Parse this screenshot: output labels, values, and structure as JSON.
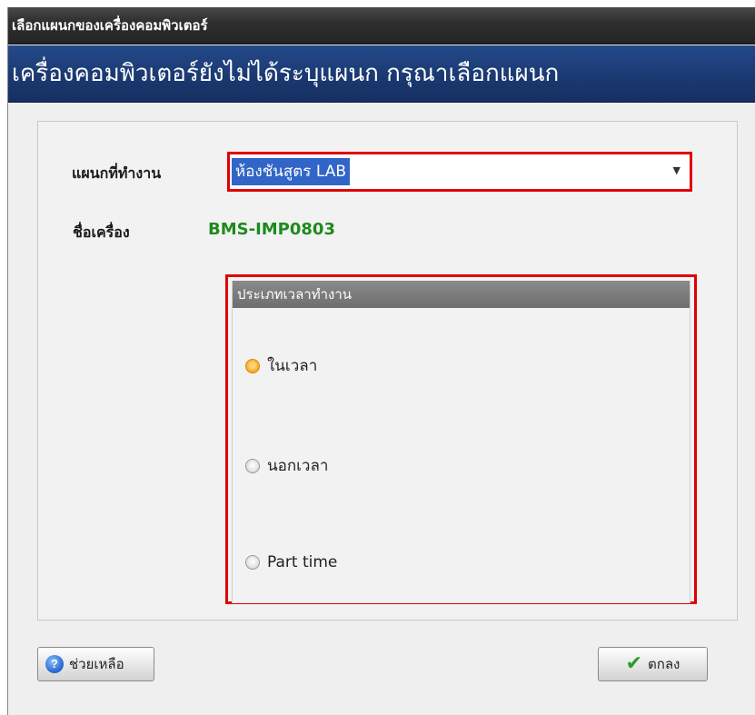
{
  "window": {
    "title": "เลือกแผนกของเครื่องคอมพิวเตอร์",
    "banner": "เครื่องคอมพิวเตอร์ยังไม่ได้ระบุแผนก กรุณาเลือกแผนก"
  },
  "form": {
    "department_label": "แผนกที่ทำงาน",
    "department_value": "ห้องชันสูตร LAB",
    "computer_name_label": "ชื่อเครื่อง",
    "computer_name_value": "BMS-IMP0803"
  },
  "work_type": {
    "group_title": "ประเภทเวลาทำงาน",
    "options": [
      {
        "label": "ในเวลา",
        "selected": true
      },
      {
        "label": "นอกเวลา",
        "selected": false
      },
      {
        "label": "Part time",
        "selected": false
      }
    ]
  },
  "buttons": {
    "help_label": "ช่วยเหลือ",
    "ok_label": "ตกลง"
  },
  "icons": {
    "dropdown": "chevron-down-icon",
    "help": "help-icon",
    "ok": "checkmark-icon"
  },
  "colors": {
    "highlight_border": "#e00000",
    "selection_bg": "#3265c8",
    "computer_name": "#1e8a1e",
    "banner_bg": "#1a3870"
  }
}
